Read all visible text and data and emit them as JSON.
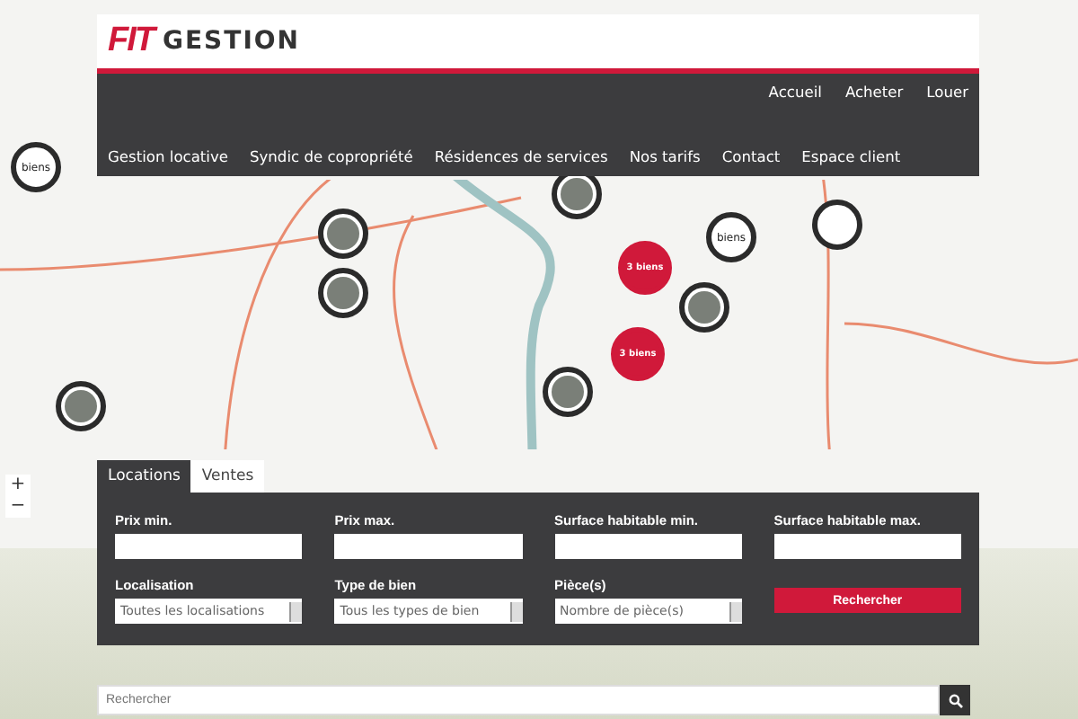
{
  "header": {
    "logo_mark": "FIT",
    "logo_text": "GESTION"
  },
  "top_links": [
    "Accueil",
    "Acheter",
    "Louer"
  ],
  "main_menu": [
    "Gestion locative",
    "Syndic de copropriété",
    "Résidences de services",
    "Nos tarifs",
    "Contact",
    "Espace client"
  ],
  "map": {
    "markers": [
      {
        "kind": "label",
        "label": "biens"
      },
      {
        "kind": "photo"
      },
      {
        "kind": "photo"
      },
      {
        "kind": "photo"
      },
      {
        "kind": "cluster",
        "label": "3 biens"
      },
      {
        "kind": "label",
        "label": "biens"
      },
      {
        "kind": "empty"
      },
      {
        "kind": "photo"
      },
      {
        "kind": "cluster",
        "label": "3 biens"
      },
      {
        "kind": "photo"
      },
      {
        "kind": "photo"
      }
    ],
    "zoom_in": "+",
    "zoom_out": "−"
  },
  "tabs": [
    {
      "label": "Locations",
      "selected": true
    },
    {
      "label": "Ventes",
      "selected": false
    }
  ],
  "search_form": {
    "fields": [
      {
        "kind": "input",
        "label": "Prix min."
      },
      {
        "kind": "input",
        "label": "Prix max."
      },
      {
        "kind": "input",
        "label": "Surface habitable min."
      },
      {
        "kind": "input",
        "label": "Surface habitable max."
      },
      {
        "kind": "select",
        "label": "Localisation",
        "value": "Toutes les localisations"
      },
      {
        "kind": "select",
        "label": "Type de bien",
        "value": "Tous les types de bien"
      },
      {
        "kind": "select",
        "label": "Pièce(s)",
        "value": "Nombre de pièce(s)"
      },
      {
        "kind": "button",
        "label": "Rechercher"
      }
    ]
  },
  "site_search": {
    "placeholder": "Rechercher"
  }
}
